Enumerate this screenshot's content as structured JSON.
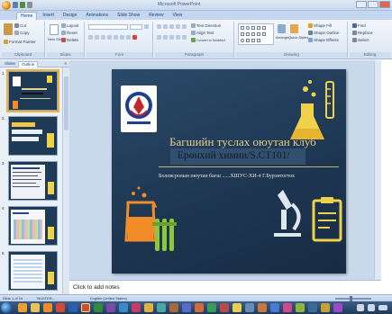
{
  "window": {
    "title": "Microsoft PowerPoint"
  },
  "tabs": [
    {
      "label": "Home"
    },
    {
      "label": "Insert"
    },
    {
      "label": "Design"
    },
    {
      "label": "Animations"
    },
    {
      "label": "Slide Show"
    },
    {
      "label": "Review"
    },
    {
      "label": "View"
    }
  ],
  "ribbon": {
    "clipboard": {
      "cut": "Cut",
      "copy": "Copy",
      "paste_label": "Paste",
      "format_painter": "Format Painter",
      "group": "Clipboard"
    },
    "slides": {
      "new_slide": "New Slide",
      "layout": "Layout",
      "reset": "Reset",
      "delete": "Delete",
      "group": "Slides"
    },
    "font": {
      "group": "Font"
    },
    "paragraph": {
      "text_direction": "Text Direction",
      "align_text": "Align Text",
      "convert_smartart": "Convert to SmartArt",
      "group": "Paragraph"
    },
    "drawing": {
      "arrange": "Arrange",
      "quick_styles": "Quick Styles",
      "shape_fill": "Shape Fill",
      "shape_outline": "Shape Outline",
      "shape_effects": "Shape Effects",
      "group": "Drawing"
    },
    "editing": {
      "find": "Find",
      "replace": "Replace",
      "select": "Select",
      "group": "Editing"
    }
  },
  "pane": {
    "tab_slides": "Slides",
    "tab_outline": "Outline",
    "close": "x"
  },
  "thumbnails": [
    {
      "num": "1"
    },
    {
      "num": "2"
    },
    {
      "num": "3"
    },
    {
      "num": "4"
    },
    {
      "num": "5"
    }
  ],
  "slide": {
    "title": "Багшийн туслах оюутан клуб",
    "subtitle": "Ерөнхий химии/S.CT101/",
    "body": "Боловсролын оюутан багш ......ХШУС-ХИ-4 Г.Бурэнтогтох"
  },
  "notes": {
    "placeholder": "Click to add notes"
  },
  "status": {
    "slide_info": "Slide 1 of 19",
    "theme": "\"BUSTER...",
    "language": "English (United States)"
  },
  "colors": {
    "title_gold": "#e7cf8b",
    "slide_bg": "#1e3752",
    "accent_orange": "#f28c28",
    "accent_yellow": "#f0d24a",
    "accent_green": "#8cc63f"
  }
}
